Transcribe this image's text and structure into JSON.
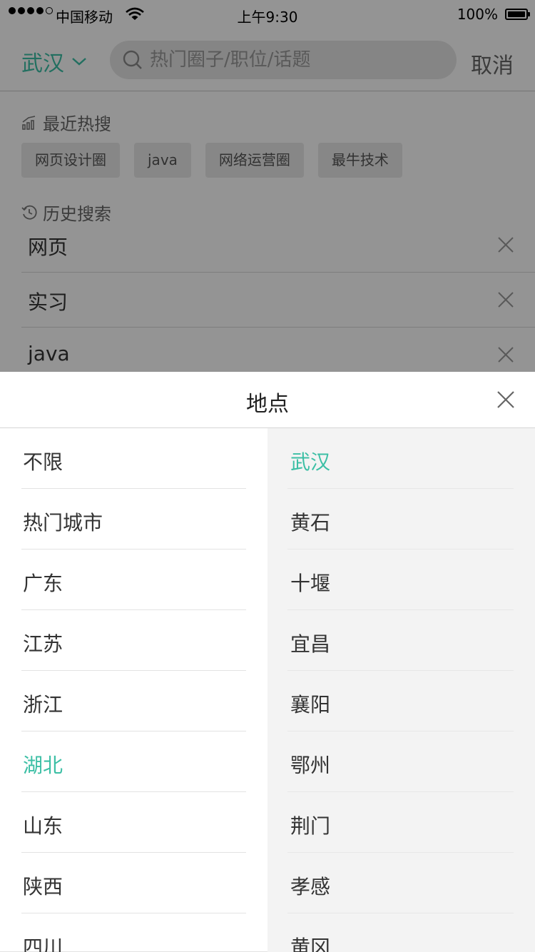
{
  "status_bar": {
    "carrier": "中国移动",
    "time": "上午9:30",
    "battery": "100%"
  },
  "search_header": {
    "city": "武汉",
    "placeholder": "热门圈子/职位/话题",
    "cancel": "取消"
  },
  "hot_search": {
    "title": "最近热搜",
    "tags": [
      "网页设计圈",
      "java",
      "网络运营圈",
      "最牛技术"
    ]
  },
  "history": {
    "title": "历史搜索",
    "items": [
      "网页",
      "实习",
      "java"
    ]
  },
  "location_sheet": {
    "title": "地点",
    "provinces": [
      "不限",
      "热门城市",
      "广东",
      "江苏",
      "浙江",
      "湖北",
      "山东",
      "陕西",
      "四川"
    ],
    "selected_province": "湖北",
    "cities": [
      "武汉",
      "黄石",
      "十堰",
      "宜昌",
      "襄阳",
      "鄂州",
      "荆门",
      "孝感",
      "黄冈"
    ],
    "selected_city": "武汉"
  },
  "colors": {
    "accent": "#3cbfa5",
    "overlay": "rgba(0,0,0,0.42)",
    "right_column_bg": "#f3f3f3"
  }
}
